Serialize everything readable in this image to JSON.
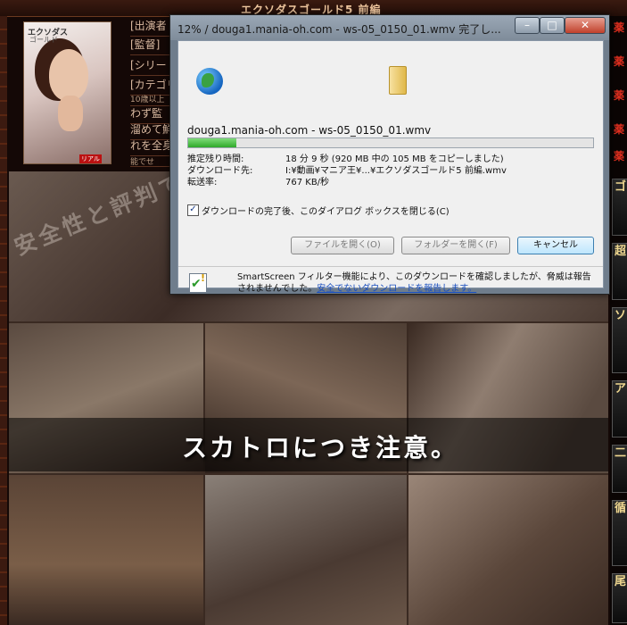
{
  "page": {
    "site_title": "エクソダスゴールド5 前編",
    "cover": {
      "title": "エクソダス",
      "subtitle": "ゴールド",
      "label": "リアル"
    },
    "info_lines": [
      "[出演者",
      "[監督]",
      "[シリー",
      "[カテゴリ",
      "10歳以上",
      "わず監",
      "溜めて鮮",
      "れを全身",
      "能でせ"
    ],
    "right_sidebar": {
      "text_items": [
        "薬",
        "薬",
        "薬",
        "薬",
        "薬"
      ],
      "ad_items": [
        "ゴ",
        "超",
        "ソ",
        "ア",
        "二",
        "循",
        "尾"
      ]
    },
    "watermark": "安全性と評判で選ぶ！アダルトサイト入会体験",
    "warning": "スカトロにつき注意。"
  },
  "dialog": {
    "title": "12% / douga1.mania-oh.com - ws-05_0150_01.wmv 完了し...",
    "window_buttons": {
      "minimize": "–",
      "maximize": "□",
      "close": "✕"
    },
    "file_name": "douga1.mania-oh.com - ws-05_0150_01.wmv",
    "progress_percent": 12,
    "fields": [
      {
        "label": "推定残り時間:",
        "value": "18 分 9 秒 (920 MB 中の 105 MB をコピーしました)"
      },
      {
        "label": "ダウンロード先:",
        "value": "I:¥動画¥マニア王¥...¥エクソダスゴールド5 前編.wmv"
      },
      {
        "label": "転送率:",
        "value": "767 KB/秒"
      }
    ],
    "close_on_complete": {
      "checked": true,
      "mark": "✓",
      "label": "ダウンロードの完了後、このダイアログ ボックスを閉じる(C)"
    },
    "buttons": {
      "open_file": "ファイルを開く(O)",
      "open_folder": "フォルダーを開く(F)",
      "cancel": "キャンセル"
    },
    "smartscreen": {
      "text": "SmartScreen フィルター機能により、このダウンロードを確認しましたが、脅威は報告されませんでした。",
      "link": "安全でないダウンロードを報告します。"
    },
    "icons": [
      "globe-icon",
      "folder-icon",
      "smartscreen-shield-icon"
    ]
  }
}
